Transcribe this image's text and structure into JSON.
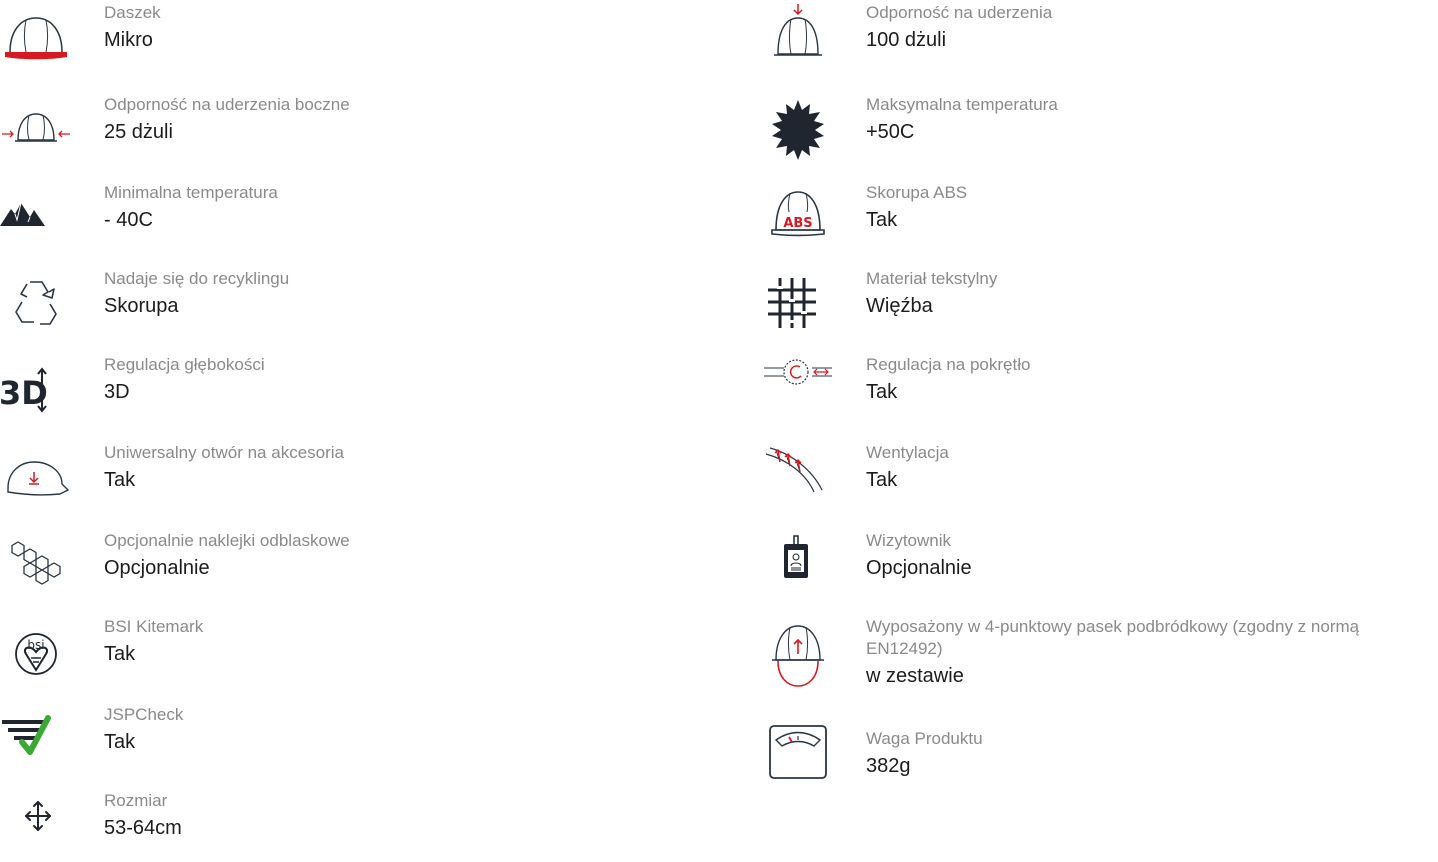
{
  "colors": {
    "accent": "#d71920",
    "icon": "#2a3644",
    "label": "#8a8a8a",
    "value": "#1c1c1c",
    "check": "#3aaa35"
  },
  "left_features": [
    {
      "icon": "helmet-red-brim-icon",
      "label": "Daszek",
      "value": "Mikro"
    },
    {
      "icon": "helmet-side-impact-icon",
      "label": "Odporność na uderzenia boczne",
      "value": "25 dżuli"
    },
    {
      "icon": "mountains-icon",
      "label": "Minimalna temperatura",
      "value": "- 40C"
    },
    {
      "icon": "recycle-icon",
      "label": "Nadaje się do recyklingu",
      "value": "Skorupa"
    },
    {
      "icon": "3d-depth-icon",
      "label": "Regulacja głębokości",
      "value": "3D"
    },
    {
      "icon": "helmet-accessory-slot-icon",
      "label": "Uniwersalny otwór na akcesoria",
      "value": "Tak"
    },
    {
      "icon": "hexagons-icon",
      "label": "Opcjonalnie naklejki odblaskowe",
      "value": "Opcjonalnie"
    },
    {
      "icon": "bsi-kitemark-icon",
      "label": "BSI Kitemark",
      "value": "Tak",
      "icon_text": "bsi"
    },
    {
      "icon": "jspcheck-icon",
      "label": "JSPCheck",
      "value": "Tak"
    },
    {
      "icon": "move-arrows-icon",
      "label": "Rozmiar",
      "value": "53-64cm"
    }
  ],
  "right_features": [
    {
      "icon": "helmet-top-impact-icon",
      "label": "Odporność na uderzenia",
      "value": "100 dżuli"
    },
    {
      "icon": "sun-icon",
      "label": "Maksymalna temperatura",
      "value": "+50C"
    },
    {
      "icon": "helmet-abs-icon",
      "label": "Skorupa ABS",
      "value": "Tak",
      "icon_text": "ABS"
    },
    {
      "icon": "textile-weave-icon",
      "label": "Materiał tekstylny",
      "value": "Więźba"
    },
    {
      "icon": "dial-ratchet-icon",
      "label": "Regulacja na pokrętło",
      "value": "Tak"
    },
    {
      "icon": "ventilation-icon",
      "label": "Wentylacja",
      "value": "Tak"
    },
    {
      "icon": "id-card-holder-icon",
      "label": "Wizytownik",
      "value": "Opcjonalnie"
    },
    {
      "icon": "chin-strap-helmet-icon",
      "label": "Wyposażony w 4-punktowy pasek podbródkowy (zgodny z normą EN12492)",
      "value": "w zestawie"
    },
    {
      "icon": "weight-scale-icon",
      "label": "Waga Produktu",
      "value": "382g"
    }
  ]
}
